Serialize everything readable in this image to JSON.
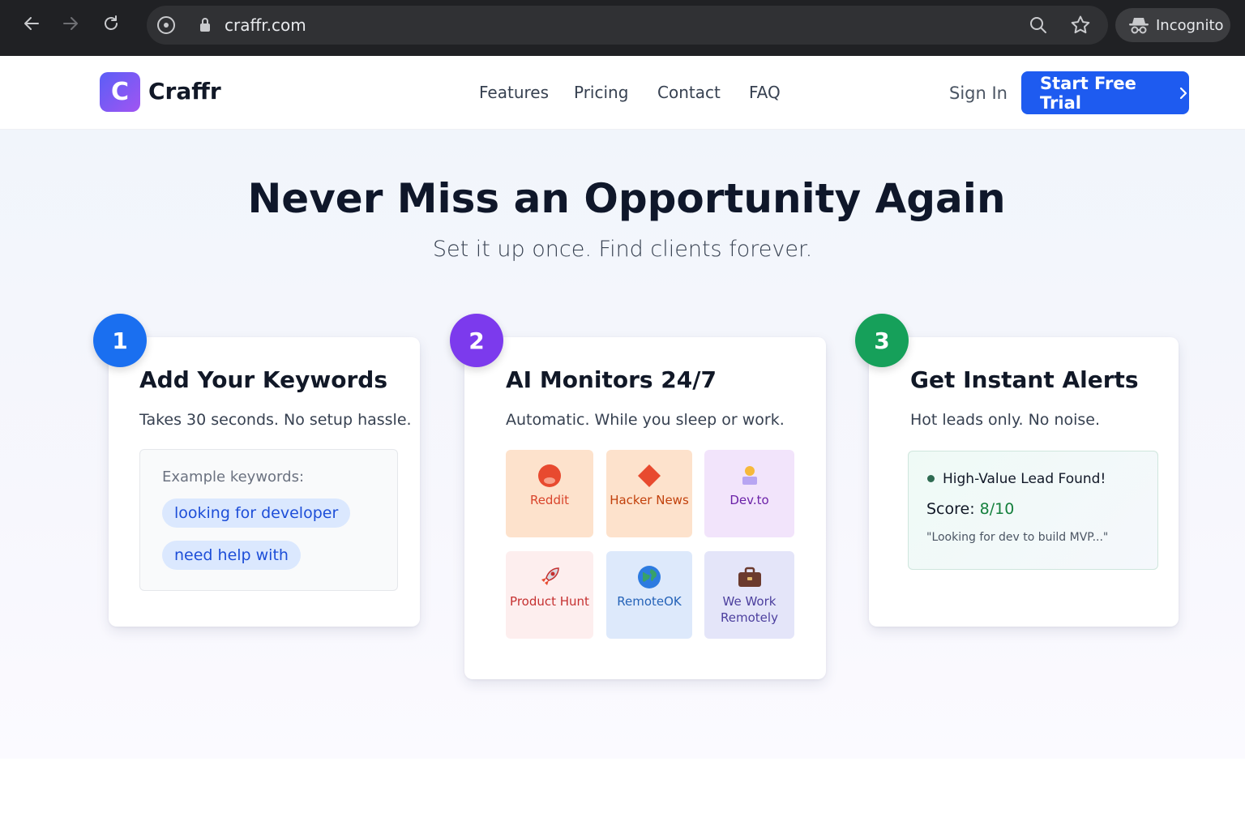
{
  "browser": {
    "url": "craffr.com",
    "incognito_label": "Incognito"
  },
  "header": {
    "logo_letter": "C",
    "logo_text": "Craffr",
    "nav": [
      "Features",
      "Pricing",
      "Contact",
      "FAQ"
    ],
    "sign_in": "Sign In",
    "cta": "Start Free Trial"
  },
  "hero": {
    "title": "Never Miss an Opportunity Again",
    "subtitle": "Set it up once. Find clients forever."
  },
  "steps": [
    {
      "number": "1",
      "title": "Add Your Keywords",
      "description": "Takes 30 seconds. No setup hassle.",
      "color": "#1a6ff0",
      "example_label": "Example keywords:",
      "keywords": [
        "looking for developer",
        "need help with"
      ]
    },
    {
      "number": "2",
      "title": "AI Monitors 24/7",
      "description": "Automatic. While you sleep or work.",
      "color": "#7c3aed",
      "platforms": [
        {
          "label": "Reddit",
          "icon": "reddit-icon",
          "bg": "#fde2cc",
          "fg": "#d9442b"
        },
        {
          "label": "Hacker News",
          "icon": "hacker-news-icon",
          "bg": "#fde2cc",
          "fg": "#c2410c"
        },
        {
          "label": "Dev.to",
          "icon": "dev-to-icon",
          "bg": "#f2e4fb",
          "fg": "#6b21a8"
        },
        {
          "label": "Product Hunt",
          "icon": "rocket-icon",
          "bg": "#fdeeee",
          "fg": "#c53030"
        },
        {
          "label": "RemoteOK",
          "icon": "globe-icon",
          "bg": "#dde9fb",
          "fg": "#2563b8"
        },
        {
          "label": "We Work Remotely",
          "icon": "briefcase-icon",
          "bg": "#e4e5f9",
          "fg": "#4c3f9e"
        }
      ]
    },
    {
      "number": "3",
      "title": "Get Instant Alerts",
      "description": "Hot leads only. No noise.",
      "color": "#16a05a",
      "alert": {
        "title": "High-Value Lead Found!",
        "score_label": "Score:",
        "score_value": "8/10",
        "quote": "\"Looking for dev to build MVP...\""
      }
    }
  ]
}
